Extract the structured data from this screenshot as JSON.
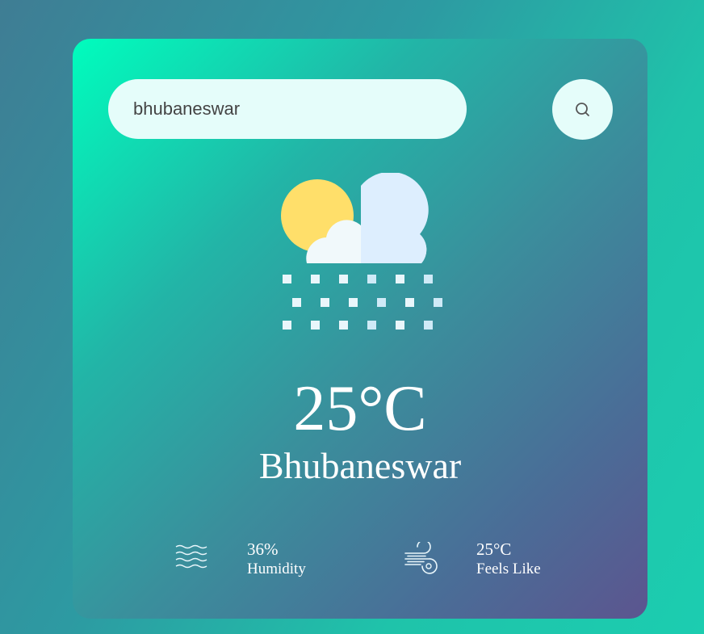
{
  "search": {
    "value": "bhubaneswar",
    "button_icon": "search-icon"
  },
  "weather": {
    "condition_icon": "cloud-sun-snow-icon",
    "temperature": "25°C",
    "city": "Bhubaneswar"
  },
  "stats": {
    "humidity": {
      "icon": "humidity-waves-icon",
      "value": "36%",
      "label": "Humidity"
    },
    "feels_like": {
      "icon": "wind-icon",
      "value": "25°C",
      "label": "Feels Like"
    }
  },
  "colors": {
    "card_gradient_start": "#00fdbd",
    "card_gradient_end": "#5c558f",
    "input_background": "#e5fdfa",
    "text": "#ffffff"
  }
}
